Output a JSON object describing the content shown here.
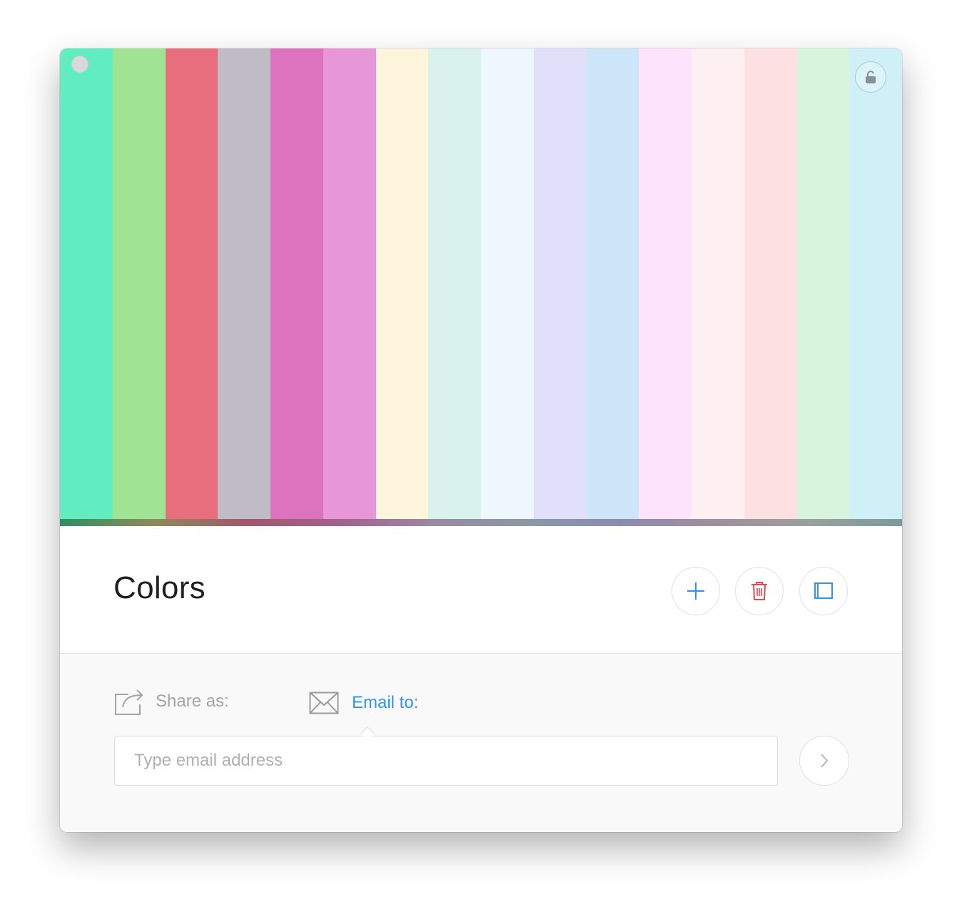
{
  "palette": {
    "title": "Colors",
    "swatches": [
      {
        "name": "mint",
        "color": "#61edbf"
      },
      {
        "name": "light-green",
        "color": "#a0e392"
      },
      {
        "name": "coral-red",
        "color": "#e96e7d"
      },
      {
        "name": "gray-lavender",
        "color": "#c0bcc6"
      },
      {
        "name": "orchid",
        "color": "#dd73be"
      },
      {
        "name": "light-orchid",
        "color": "#e797d8"
      },
      {
        "name": "cream",
        "color": "#fef5dc"
      },
      {
        "name": "pale-teal",
        "color": "#daf2ee"
      },
      {
        "name": "alice-blue",
        "color": "#eef7fd"
      },
      {
        "name": "lavender",
        "color": "#e1e0fb"
      },
      {
        "name": "light-sky",
        "color": "#cde6f9"
      },
      {
        "name": "pale-pink",
        "color": "#fde3fb"
      },
      {
        "name": "blush",
        "color": "#fef0f0"
      },
      {
        "name": "light-rose",
        "color": "#fde0e1"
      },
      {
        "name": "honeydew",
        "color": "#d8f4dc"
      },
      {
        "name": "light-cyan",
        "color": "#cff0f7"
      }
    ],
    "gradient_colors": [
      "#2f8f63",
      "#8e8a5e",
      "#a0586b",
      "#a2628f",
      "#9a8aa0",
      "#8a98a8",
      "#8b8bb0",
      "#a08f9f",
      "#9aa09e",
      "#7c9a9b"
    ]
  },
  "window": {
    "close_icon": "close-dot-icon",
    "lock_icon": "unlock-icon"
  },
  "toolbar": {
    "add_icon": "plus-icon",
    "delete_icon": "trash-icon",
    "sidebar_icon": "sidebar-panel-icon",
    "add_color": "#2f95ef",
    "delete_color": "#e84a4a",
    "sidebar_color": "#2f95ef"
  },
  "share": {
    "share_as_label": "Share as:",
    "email_to_label": "Email to:",
    "email_placeholder": "Type email address",
    "email_value": "",
    "active_color": "#2f95ef",
    "inactive_color": "#a4a4a4"
  }
}
